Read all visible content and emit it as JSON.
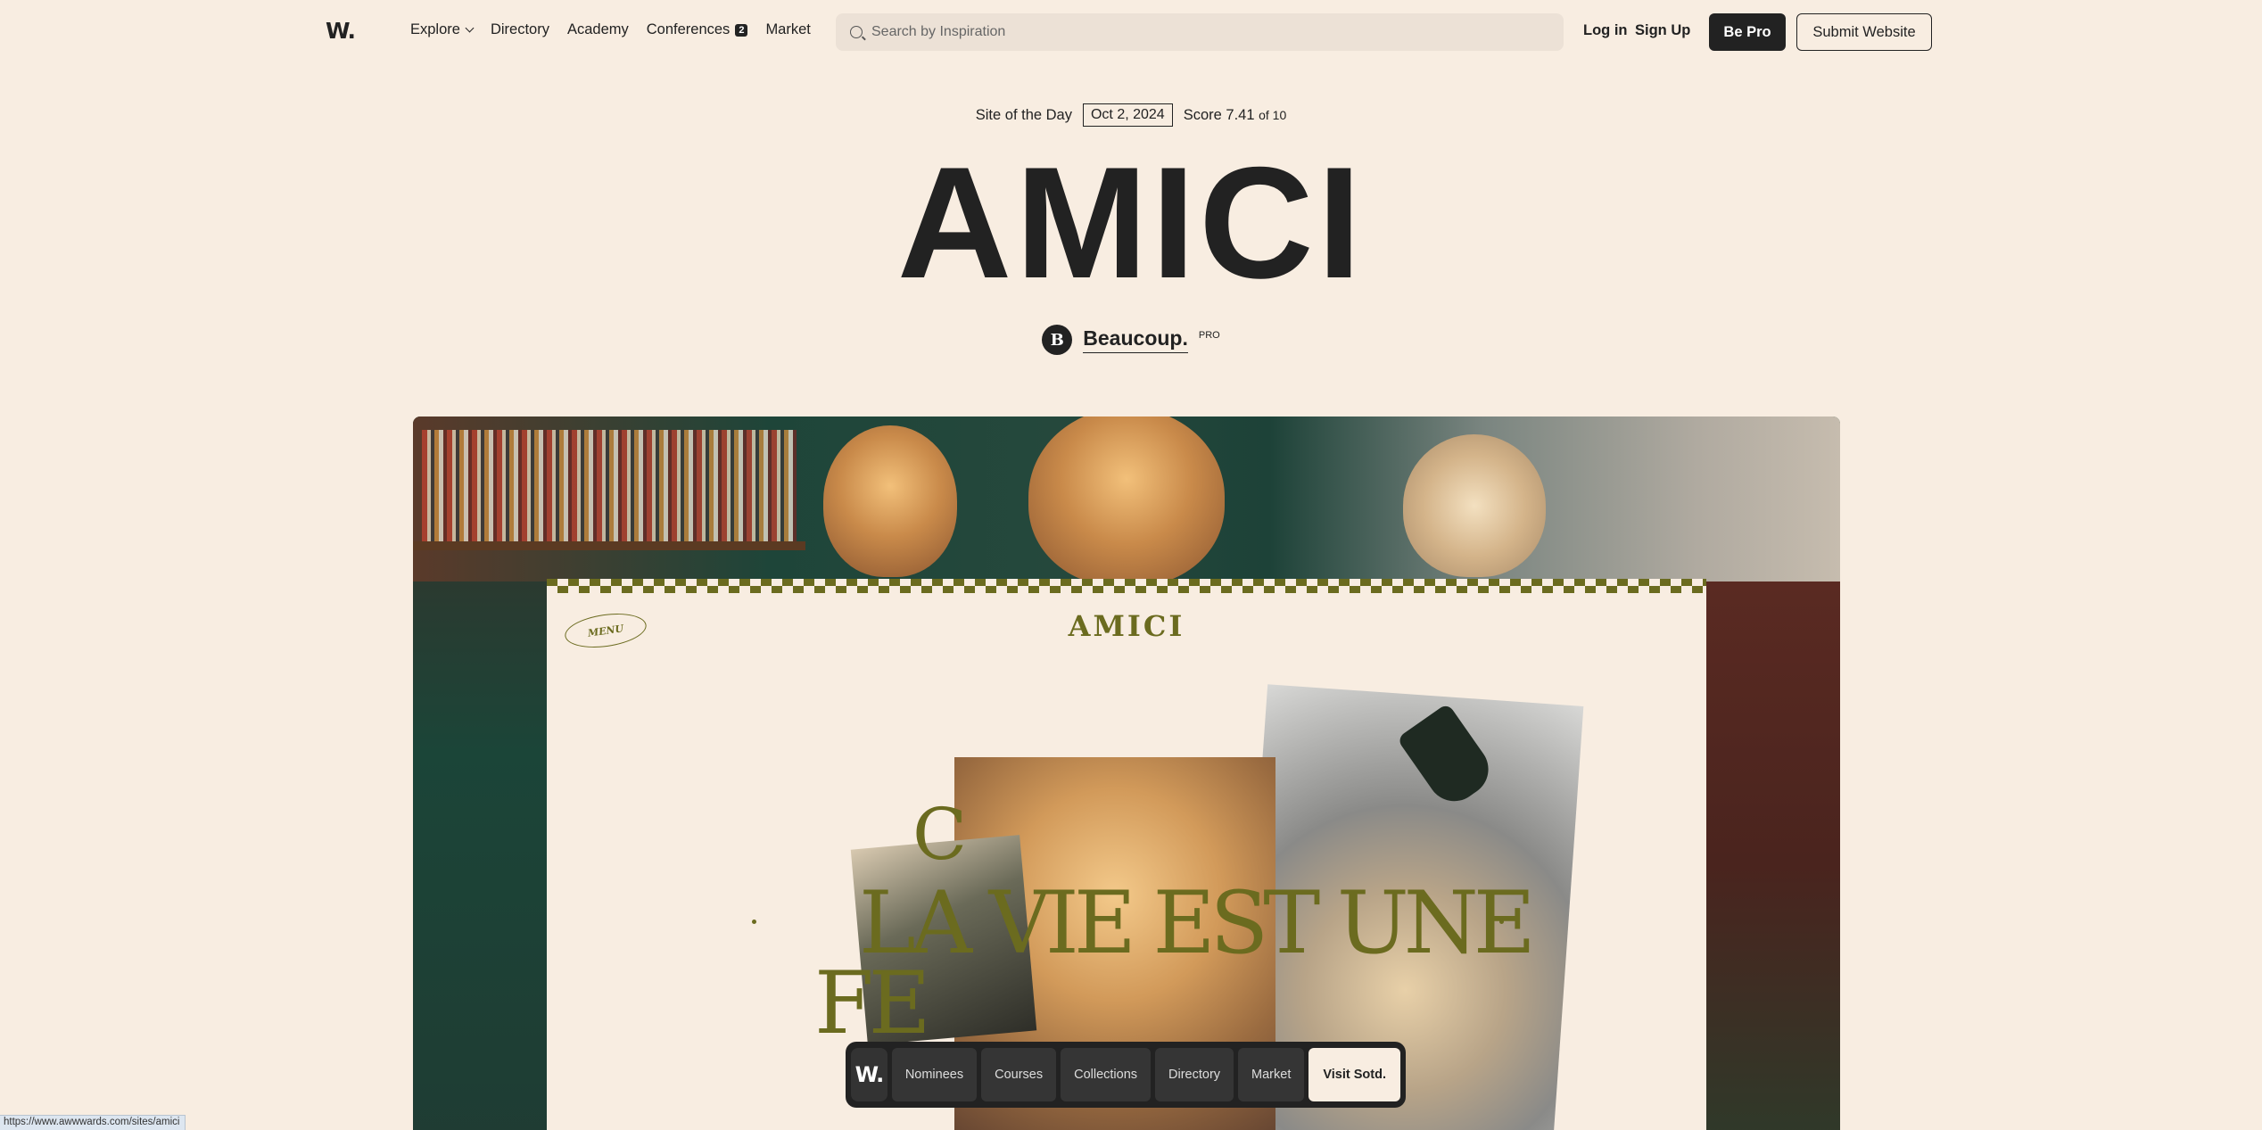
{
  "nav": {
    "logo": "W.",
    "links": [
      "Explore",
      "Directory",
      "Academy",
      "Conferences",
      "Market"
    ],
    "conferences_badge": "2",
    "search_placeholder": "Search by Inspiration",
    "login": "Log in",
    "signup": "Sign Up",
    "be_pro": "Be Pro",
    "submit": "Submit Website"
  },
  "hero": {
    "award": "Site of the Day",
    "date": "Oct 2, 2024",
    "score_label": "Score 7.41",
    "score_of": "of 10",
    "title": "AMICI",
    "agency_initial": "B",
    "agency": "Beaucoup.",
    "agency_tag": "PRO"
  },
  "preview": {
    "menu_label": "MENU",
    "logo": "AMICI",
    "headline_top": "C",
    "headline_line1": "LA VIE EST UNE",
    "headline_line2": "FE"
  },
  "bottom_bar": {
    "logo": "W.",
    "items": [
      "Nominees",
      "Courses",
      "Collections",
      "Directory",
      "Market"
    ],
    "visit": "Visit Sotd."
  },
  "status_url": "https://www.awwwards.com/sites/amici"
}
